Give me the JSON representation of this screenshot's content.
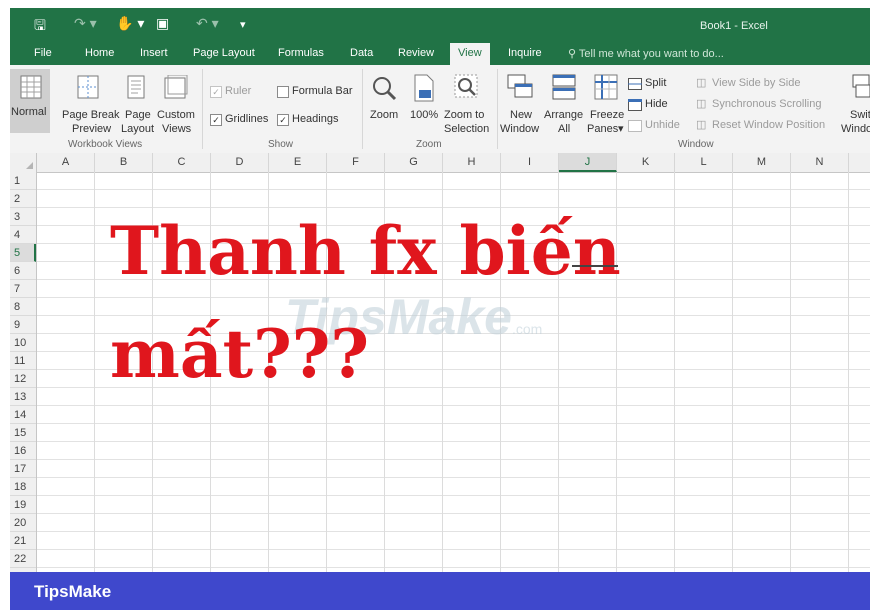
{
  "window": {
    "title": "Book1 - Excel"
  },
  "quick_access": {
    "save_icon": "floppy-disk-icon",
    "redo_icon": "redo-icon",
    "touch_icon": "touch-mode-icon",
    "share_icon": "camera-icon",
    "undo_icon": "undo-icon",
    "customize_icon": "customize-arrow-icon"
  },
  "tabs": [
    "File",
    "Home",
    "Insert",
    "Page Layout",
    "Formulas",
    "Data",
    "Review",
    "View",
    "Inquire"
  ],
  "active_tab": "View",
  "tell_me": "Tell me what you want to do...",
  "ribbon": {
    "workbook_views": {
      "label": "Workbook Views",
      "normal": "Normal",
      "page_break_1": "Page Break",
      "page_break_2": "Preview",
      "page_layout_1": "Page",
      "page_layout_2": "Layout",
      "custom_1": "Custom",
      "custom_2": "Views"
    },
    "show": {
      "label": "Show",
      "ruler": "Ruler",
      "formula_bar": "Formula Bar",
      "gridlines": "Gridlines",
      "headings": "Headings",
      "ruler_checked": true,
      "formula_bar_checked": false,
      "gridlines_checked": true,
      "headings_checked": true
    },
    "zoom": {
      "label": "Zoom",
      "zoom": "Zoom",
      "hundred": "100%",
      "zoom_sel_1": "Zoom to",
      "zoom_sel_2": "Selection"
    },
    "window": {
      "label": "Window",
      "new_1": "New",
      "new_2": "Window",
      "arrange_1": "Arrange",
      "arrange_2": "All",
      "freeze_1": "Freeze",
      "freeze_2": "Panes",
      "split": "Split",
      "hide": "Hide",
      "unhide": "Unhide",
      "side_by_side": "View Side by Side",
      "sync_scroll": "Synchronous Scrolling",
      "reset_pos": "Reset Window Position",
      "switch_1": "Switch",
      "switch_2": "Windows"
    }
  },
  "sheet": {
    "columns": [
      "A",
      "B",
      "C",
      "D",
      "E",
      "F",
      "G",
      "H",
      "I",
      "J",
      "K",
      "L",
      "M",
      "N"
    ],
    "selected_column": "J",
    "rows": [
      "1",
      "2",
      "3",
      "4",
      "5",
      "6",
      "7",
      "8",
      "9",
      "10",
      "11",
      "12",
      "13",
      "14",
      "15",
      "16",
      "17",
      "18",
      "19",
      "20",
      "21",
      "22"
    ],
    "selected_row": "5"
  },
  "overlay": {
    "line1": "Thanh fx biến",
    "line2": "mất???",
    "color": "#e0161d"
  },
  "watermark": {
    "text": "TipsMake",
    "suffix": ".com"
  },
  "footer": {
    "brand": "TipsMake",
    "color": "#3f48cc"
  },
  "colors": {
    "excel_green": "#217346",
    "ribbon_bg": "#f3f3f3"
  }
}
